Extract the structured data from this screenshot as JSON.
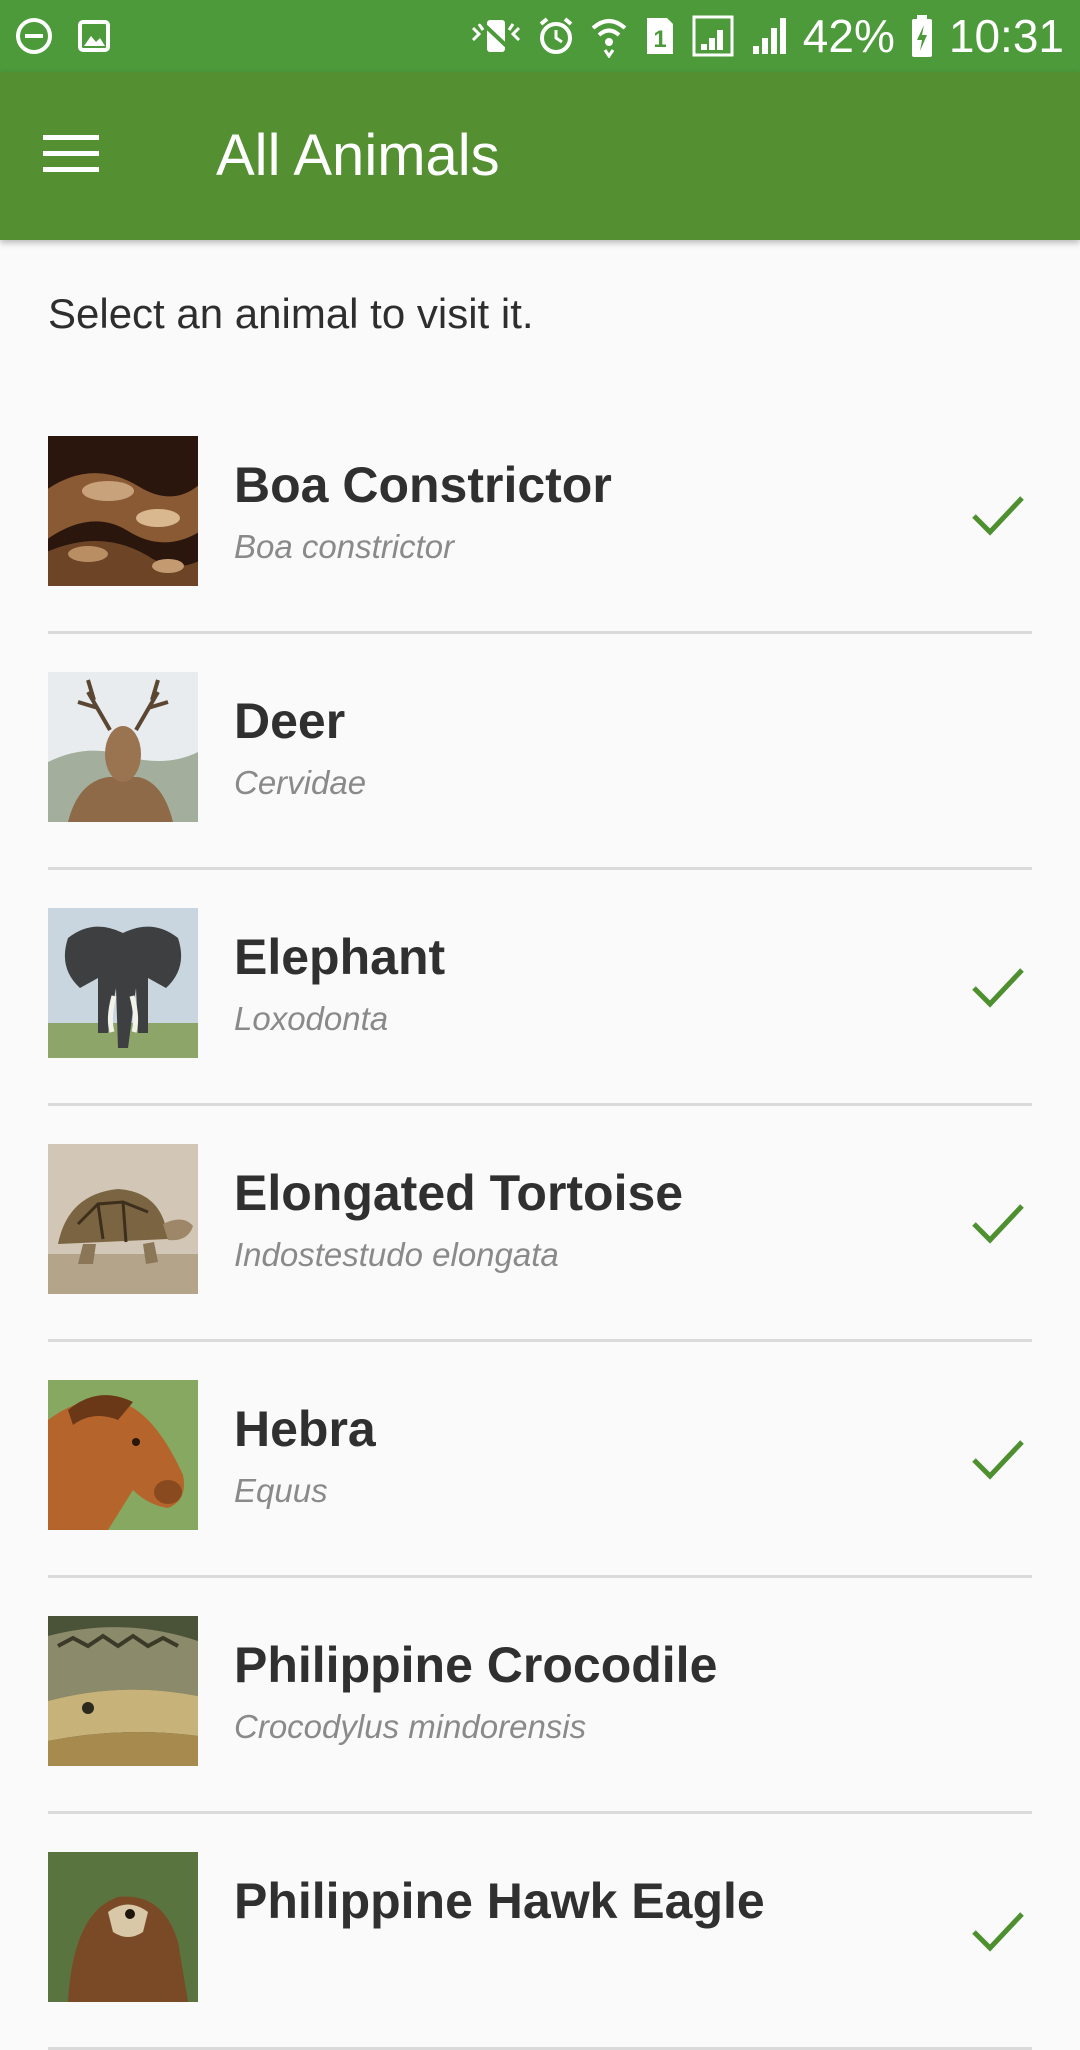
{
  "status_bar": {
    "battery": "42%",
    "time": "10:31",
    "sim_slot": "1",
    "icons_left": [
      "do-not-disturb-icon",
      "image-icon"
    ],
    "icons_right": [
      "vibrate-icon",
      "alarm-icon",
      "wifi-icon",
      "sim-icon",
      "signal-icon",
      "signal-icon",
      "battery-charging-icon"
    ],
    "color": "#4c9a3a"
  },
  "app_bar": {
    "title": "All Animals",
    "menu_icon": "hamburger-menu-icon",
    "color": "#548f32"
  },
  "intro_text": "Select an animal to visit it.",
  "accent_color": "#4e8f30",
  "animals": [
    {
      "name": "Boa Constrictor",
      "scientific": "Boa constrictor",
      "visited": true,
      "image": "snake-photo"
    },
    {
      "name": "Deer",
      "scientific": "Cervidae",
      "visited": false,
      "image": "deer-photo"
    },
    {
      "name": "Elephant",
      "scientific": "Loxodonta",
      "visited": true,
      "image": "elephant-photo"
    },
    {
      "name": "Elongated Tortoise",
      "scientific": "Indostestudo elongata",
      "visited": true,
      "image": "tortoise-photo"
    },
    {
      "name": "Hebra",
      "scientific": "Equus",
      "visited": true,
      "image": "horse-photo"
    },
    {
      "name": "Philippine Crocodile",
      "scientific": "Crocodylus mindorensis",
      "visited": false,
      "image": "crocodile-photo"
    },
    {
      "name": "Philippine Hawk Eagle",
      "scientific": "",
      "visited": true,
      "image": "eagle-photo"
    }
  ]
}
